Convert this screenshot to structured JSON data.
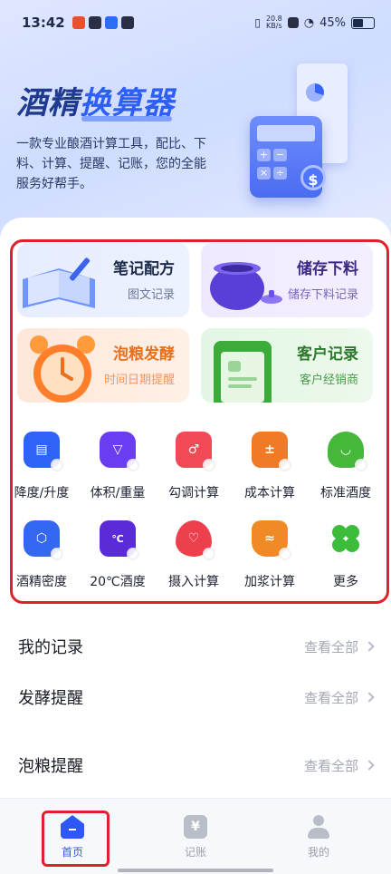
{
  "status_bar": {
    "time": "13:42",
    "net_speed_value": "20.8",
    "net_speed_unit": "KB/s",
    "battery": "45%"
  },
  "hero": {
    "title_part1": "酒精",
    "title_part2": "换算器",
    "description": "一款专业酿酒计算工具，配比、下料、计算、提醒、记账，您的全能服务好帮手。"
  },
  "cards": [
    {
      "title": "笔记配方",
      "subtitle": "图文记录"
    },
    {
      "title": "储存下料",
      "subtitle": "储存下料记录"
    },
    {
      "title": "泡粮发酵",
      "subtitle": "时间日期提醒"
    },
    {
      "title": "客户记录",
      "subtitle": "客户经销商"
    }
  ],
  "tools": [
    {
      "label": "降度/升度",
      "color": "#2f63f5",
      "icon": "document-icon"
    },
    {
      "label": "体积/重量",
      "color": "#6a3df0",
      "icon": "triangle-icon"
    },
    {
      "label": "勾调计算",
      "color": "#ef4a55",
      "icon": "gender-icon"
    },
    {
      "label": "成本计算",
      "color": "#f07a26",
      "icon": "calculator-icon"
    },
    {
      "label": "标准酒度",
      "color": "#45b83a",
      "icon": "bowl-icon"
    },
    {
      "label": "酒精密度",
      "color": "#3467f2",
      "icon": "hexagon-icon"
    },
    {
      "label": "20℃酒度",
      "color": "#5b2bd8",
      "icon": "thermometer-icon"
    },
    {
      "label": "摄入计算",
      "color": "#ee3f4d",
      "icon": "drop-heart-icon"
    },
    {
      "label": "加浆计算",
      "color": "#f08a24",
      "icon": "wave-icon"
    },
    {
      "label": "更多",
      "color": "#3dbb3a",
      "icon": "clover-icon"
    }
  ],
  "rows": [
    {
      "title": "我的记录",
      "more": "查看全部"
    },
    {
      "title": "发酵提醒",
      "more": "查看全部"
    },
    {
      "title": "泡粮提醒",
      "more": "查看全部"
    }
  ],
  "tabs": [
    {
      "label": "首页",
      "active": true
    },
    {
      "label": "记账",
      "active": false
    },
    {
      "label": "我的",
      "active": false
    }
  ],
  "tab_icons": {
    "ledger_glyph": "¥"
  },
  "hero_art": {
    "calc_keys": [
      "+",
      "−",
      "×",
      "÷"
    ],
    "coin": "$"
  }
}
